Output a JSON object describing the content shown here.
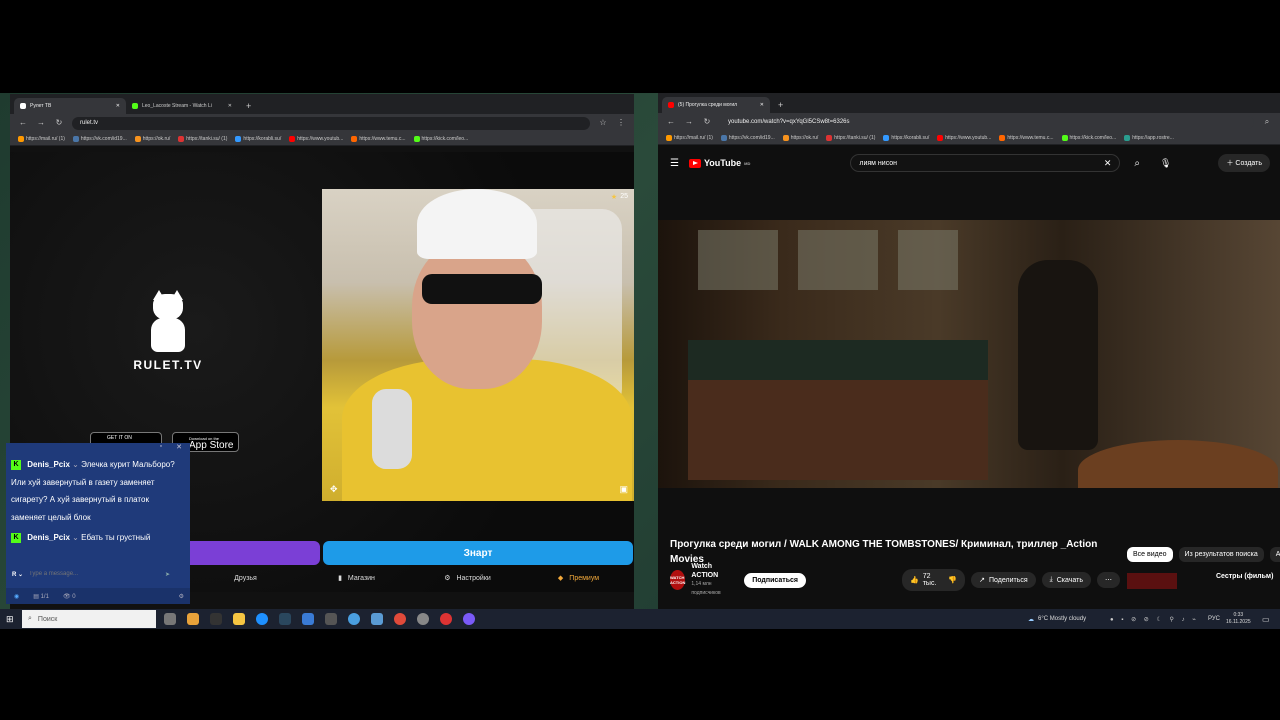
{
  "left_browser": {
    "tabs": [
      {
        "label": "Рулет ТВ"
      },
      {
        "label": "Leo_Lacoste Stream - Watch Li"
      }
    ],
    "url": "rulet.tv",
    "bookmarks": [
      "https://mail.ru/ (1)",
      "https://vk.com/id19...",
      "https://ok.ru/",
      "https://tanki.su/ (1)",
      "https://korabli.su/",
      "https://www.youtub...",
      "https://www.temu.c...",
      "https://kick.com/leo..."
    ]
  },
  "rulet": {
    "logo_text": "RULET.TV",
    "store1": "GET IT ON",
    "store2_small": "Download on the",
    "store2": "App Store",
    "viewer_count": "25",
    "blue_button": "Знарт",
    "nav": [
      {
        "label": "Друзья",
        "icon": "friends-icon"
      },
      {
        "label": "Магазин",
        "icon": "shop-icon"
      },
      {
        "label": "Настройки",
        "icon": "gear-icon"
      },
      {
        "label": "Премиум",
        "icon": "premium-icon"
      }
    ]
  },
  "chat": {
    "messages": [
      {
        "user": "Denis_Pcix",
        "text": "Элечка курит Мальборо? Или хуй завернутый в газету заменяет сигарету? А хуй завернутый в платок заменяет целый блок"
      },
      {
        "user": "Denis_Pcix",
        "text": "Ебать ты грустный"
      }
    ],
    "placeholder": "Type a message...",
    "page": "1/1",
    "viewers": "0"
  },
  "right_browser": {
    "tab": "(5) Прогулка среди могил",
    "url": "youtube.com/watch?v=qxYqGl5CSw8t=6326s",
    "bookmarks": [
      "https://mail.ru/ (1)",
      "https://vk.com/id19...",
      "https://ok.ru/",
      "https://tanki.su/ (1)",
      "https://korabli.su/",
      "https://www.youtub...",
      "https://www.temu.c...",
      "https://kick.com/leo...",
      "https://app.rostre..."
    ]
  },
  "youtube": {
    "logo": "YouTube",
    "logo_sup": "MD",
    "search": "лиям нисон",
    "create": "Создать",
    "title": "Прогулка среди могил / WALK AMONG THE TOMBSTONES/ Криминал, триллер _Action Movies",
    "channel": "Watch ACTION",
    "avatar_text": "WATCH ACTION",
    "subs": "1,14 млн подписчиков",
    "subscribe": "Подписаться",
    "likes": "72 тыс.",
    "share": "Поделиться",
    "download": "Скачать",
    "chips": [
      "Все видео",
      "Из результатов поиска",
      "А"
    ],
    "side_title": "Сестры (фильм)"
  },
  "taskbar": {
    "search": "Поиск",
    "weather": "6°C  Mostly cloudy",
    "lang": "РУС",
    "time": "0:33",
    "date": "16.11.2025"
  }
}
